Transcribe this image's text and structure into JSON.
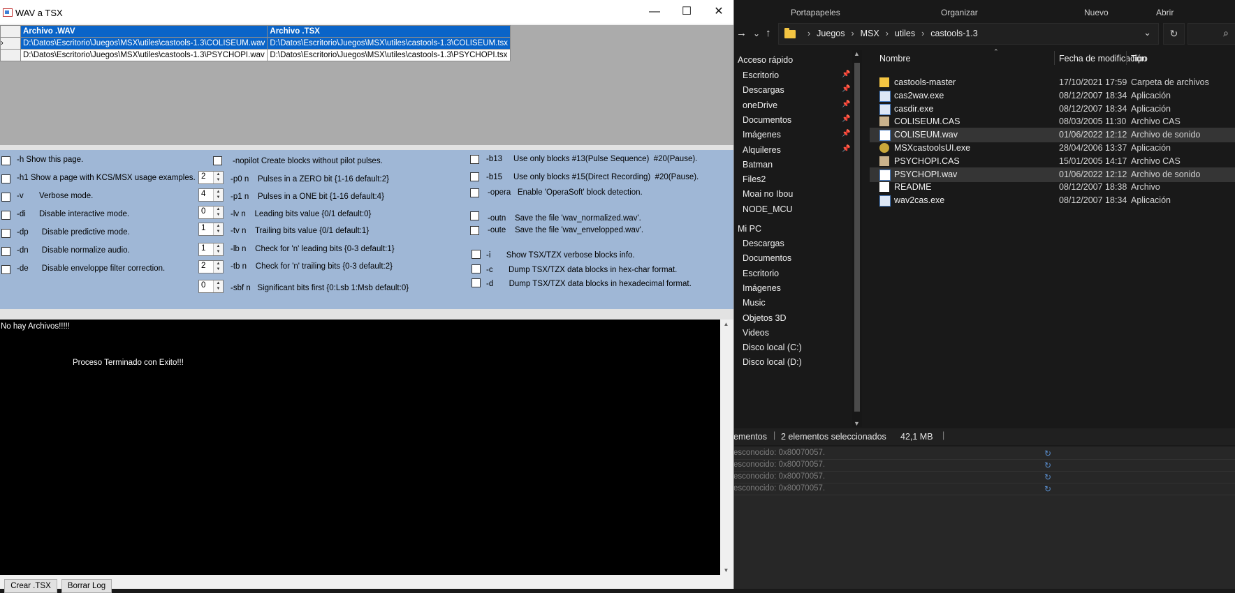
{
  "explorer": {
    "ribbon": {
      "portapapeles": "Portapapeles",
      "organizar": "Organizar",
      "nuevo": "Nuevo",
      "abrir": "Abrir"
    },
    "nav": {
      "forward": "→",
      "recent": "⌄",
      "up": "↑"
    },
    "breadcrumb": [
      "Juegos",
      "MSX",
      "utiles",
      "castools-1.3"
    ],
    "refresh": "↻",
    "search": "⌕",
    "quick_access": "Acceso rápido",
    "nav_items": [
      {
        "label": "Escritorio",
        "pinned": true
      },
      {
        "label": "Descargas",
        "pinned": true
      },
      {
        "label": "oneDrive",
        "pinned": true
      },
      {
        "label": "Documentos",
        "pinned": true
      },
      {
        "label": "Imágenes",
        "pinned": true
      },
      {
        "label": "Alquileres",
        "pinned": true
      },
      {
        "label": "Batman",
        "pinned": false
      },
      {
        "label": "Files2",
        "pinned": false
      },
      {
        "label": "Moai no Ibou",
        "pinned": false
      },
      {
        "label": "NODE_MCU",
        "pinned": false
      }
    ],
    "mi_pc": "Mi PC",
    "pc_items": [
      "Descargas",
      "Documentos",
      "Escritorio",
      "Imágenes",
      "Music",
      "Objetos 3D",
      "Videos",
      "Disco local (C:)",
      "Disco local (D:)"
    ],
    "columns": {
      "name": "Nombre",
      "date": "Fecha de modificación",
      "type": "Tipo"
    },
    "files": [
      {
        "name": "castools-master",
        "date": "17/10/2021 17:59",
        "type": "Carpeta de archivos",
        "icon": "folder",
        "selected": false
      },
      {
        "name": "cas2wav.exe",
        "date": "08/12/2007 18:34",
        "type": "Aplicación",
        "icon": "exe",
        "selected": false
      },
      {
        "name": "casdir.exe",
        "date": "08/12/2007 18:34",
        "type": "Aplicación",
        "icon": "exe",
        "selected": false
      },
      {
        "name": "COLISEUM.CAS",
        "date": "08/03/2005 11:30",
        "type": "Archivo CAS",
        "icon": "cas",
        "selected": false
      },
      {
        "name": "COLISEUM.wav",
        "date": "01/06/2022 12:12",
        "type": "Archivo de sonido",
        "icon": "wav",
        "selected": true
      },
      {
        "name": "MSXcastoolsUI.exe",
        "date": "28/04/2006 13:37",
        "type": "Aplicación",
        "icon": "app",
        "selected": false
      },
      {
        "name": "PSYCHOPI.CAS",
        "date": "15/01/2005 14:17",
        "type": "Archivo CAS",
        "icon": "cas",
        "selected": false
      },
      {
        "name": "PSYCHOPI.wav",
        "date": "01/06/2022 12:12",
        "type": "Archivo de sonido",
        "icon": "wav",
        "selected": true
      },
      {
        "name": "README",
        "date": "08/12/2007 18:38",
        "type": "Archivo",
        "icon": "doc",
        "selected": false
      },
      {
        "name": "wav2cas.exe",
        "date": "08/12/2007 18:34",
        "type": "Aplicación",
        "icon": "exe",
        "selected": false
      }
    ],
    "status": {
      "count_partial": "ementos",
      "selected": "2 elementos seleccionados",
      "size": "42,1 MB"
    },
    "errors": [
      "esconocido: 0x80070057.",
      "esconocido: 0x80070057.",
      "esconocido: 0x80070057.",
      "esconocido: 0x80070057."
    ]
  },
  "window": {
    "title": "WAV a TSX",
    "controls": {
      "minimize": "—",
      "maximize": "☐",
      "close": "✕"
    },
    "grid": {
      "headers": [
        "Archivo .WAV",
        "Archivo .TSX"
      ],
      "rows": [
        [
          "D:\\Datos\\Escritorio\\Juegos\\MSX\\utiles\\castools-1.3\\COLISEUM.wav",
          "D:\\Datos\\Escritorio\\Juegos\\MSX\\utiles\\castools-1.3\\COLISEUM.tsx"
        ],
        [
          "D:\\Datos\\Escritorio\\Juegos\\MSX\\utiles\\castools-1.3\\PSYCHOPI.wav",
          "D:\\Datos\\Escritorio\\Juegos\\MSX\\utiles\\castools-1.3\\PSYCHOPI.tsx"
        ]
      ],
      "row_marker": "›"
    },
    "options_col1": [
      "-h Show this page.",
      "-h1 Show a page with KCS/MSX usage examples.",
      "-v       Verbose mode.",
      "-di      Disable interactive mode.",
      "-dp      Disable predictive mode.",
      "-dn      Disable normalize audio.",
      "-de      Disable enveloppe filter correction."
    ],
    "nopilot": "-nopilot Create blocks without pilot pulses.",
    "options_col2": [
      {
        "value": "2",
        "text": "-p0 n    Pulses in a ZERO bit {1-16 default:2}"
      },
      {
        "value": "4",
        "text": "-p1 n    Pulses in a ONE bit {1-16 default:4}"
      },
      {
        "value": "0",
        "text": "-lv n    Leading bits value {0/1 default:0}"
      },
      {
        "value": "1",
        "text": "-tv n    Trailing bits value {0/1 default:1}"
      },
      {
        "value": "1",
        "text": "-lb n    Check for 'n' leading bits {0-3 default:1}"
      },
      {
        "value": "2",
        "text": "-tb n    Check for 'n' trailing bits {0-3 default:2}"
      },
      {
        "value": "0",
        "text": "-sbf n   Significant bits first {0:Lsb 1:Msb default:0}"
      }
    ],
    "options_col3": [
      "-b13     Use only blocks #13(Pulse Sequence)  #20(Pause).",
      "-b15     Use only blocks #15(Direct Recording)  #20(Pause).",
      "-opera   Enable 'OperaSoft' block detection.",
      "-outn    Save the file 'wav_normalized.wav'.",
      "-oute    Save the file 'wav_envelopped.wav'.",
      "-i       Show TSX/TZX verbose blocks info.",
      "-c       Dump TSX/TZX data blocks in hex-char format.",
      "-d       Dump TSX/TZX data blocks in hexadecimal format."
    ],
    "log_lines": [
      "No hay Archivos!!!!!",
      "Proceso Terminado con Exito!!!"
    ],
    "buttons": {
      "crear": "Crear .TSX",
      "borrar": "Borrar Log"
    }
  }
}
